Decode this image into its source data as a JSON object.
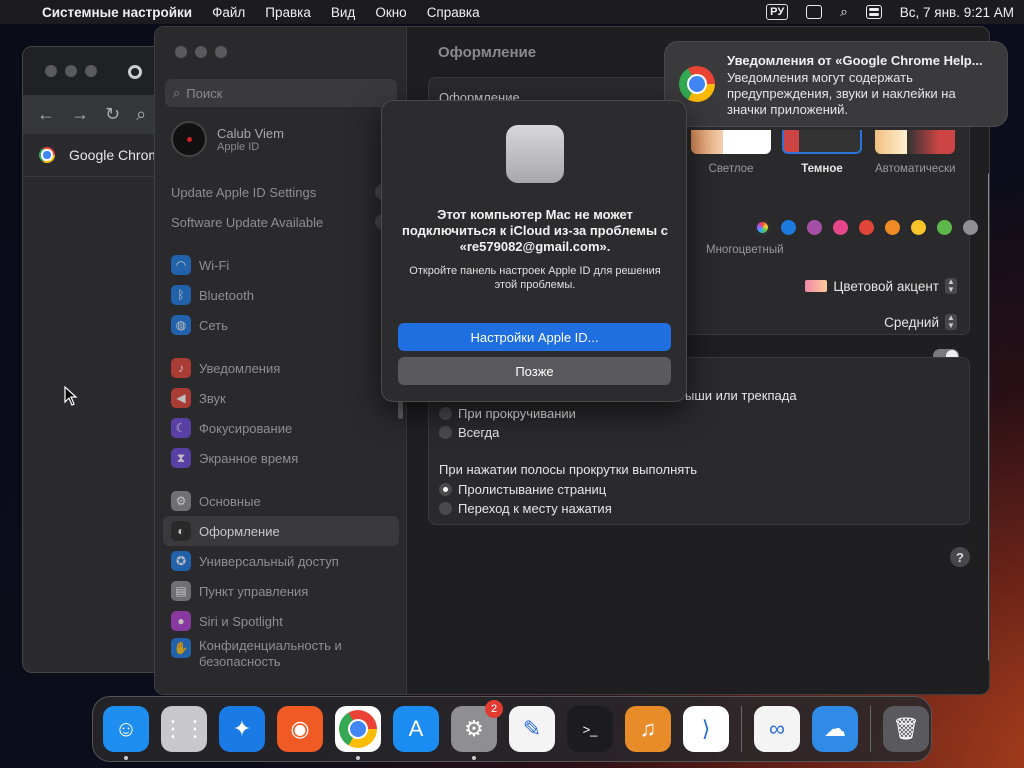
{
  "menubar": {
    "app_name": "Системные настройки",
    "items": [
      "Файл",
      "Правка",
      "Вид",
      "Окно",
      "Справка"
    ],
    "keyboard_layout": "РУ",
    "datetime": "Вс, 7 янв.  9:21 AM"
  },
  "chrome_window": {
    "bookmark_label": "Google Chrom"
  },
  "settings": {
    "search_placeholder": "Поиск",
    "profile": {
      "name": "Calub Viem",
      "sub": "Apple ID"
    },
    "alerts": [
      {
        "label": "Update Apple ID Settings",
        "badge": "1"
      },
      {
        "label": "Software Update Available",
        "badge": "1"
      }
    ],
    "group1": [
      {
        "label": "Wi-Fi",
        "icon": "wifi-icon",
        "color": "#1f7ae0"
      },
      {
        "label": "Bluetooth",
        "icon": "bluetooth-icon",
        "color": "#1f7ae0"
      },
      {
        "label": "Сеть",
        "icon": "globe-icon",
        "color": "#1f7ae0"
      }
    ],
    "group2": [
      {
        "label": "Уведомления",
        "icon": "bell-icon",
        "color": "#e0453a"
      },
      {
        "label": "Звук",
        "icon": "speaker-icon",
        "color": "#e0453a"
      },
      {
        "label": "Фокусирование",
        "icon": "moon-icon",
        "color": "#6c4ad8"
      },
      {
        "label": "Экранное время",
        "icon": "hourglass-icon",
        "color": "#6c4ad8"
      }
    ],
    "group3": [
      {
        "label": "Основные",
        "icon": "gear-icon",
        "color": "#8e8e93"
      },
      {
        "label": "Оформление",
        "icon": "appearance-icon",
        "color": "#222222",
        "selected": true
      },
      {
        "label": "Универсальный доступ",
        "icon": "accessibility-icon",
        "color": "#1f7ae0"
      },
      {
        "label": "Пункт управления",
        "icon": "control-center-icon",
        "color": "#8e8e93"
      },
      {
        "label": "Siri и Spotlight",
        "icon": "siri-icon",
        "color": "#b040d0"
      },
      {
        "label": "Конфиденциальность и безопасность",
        "icon": "hand-icon",
        "color": "#1f7ae0"
      }
    ],
    "content_title": "Оформление",
    "appearance_label": "Оформление",
    "themes": [
      {
        "label": "Светлое"
      },
      {
        "label": "Темное",
        "selected": true
      },
      {
        "label": "Автоматически"
      }
    ],
    "accent_colors": [
      "#ffffff",
      "#1f7ae0",
      "#a550a7",
      "#e6468c",
      "#e0453a",
      "#f08a24",
      "#f7c42a",
      "#5db84a",
      "#8e8e93"
    ],
    "multicolor_label": "Многоцветный",
    "accent_label": "Цветовой акцент",
    "size_label": "Средний",
    "scroll_header_partial": "ыши или трекпада",
    "scroll_options": [
      {
        "label": "При прокручивании",
        "checked": false
      },
      {
        "label": "Всегда",
        "checked": false
      }
    ],
    "click_header": "При нажатии полосы прокрутки выполнять",
    "click_options": [
      {
        "label": "Пролистывание страниц",
        "checked": true
      },
      {
        "label": "Переход к месту нажатия",
        "checked": false
      }
    ],
    "help": "?"
  },
  "notification": {
    "title": "Уведомления от «Google Chrome Help...",
    "body": "Уведомления могут содержать предупреждения, звуки и наклейки на значки приложений."
  },
  "dialog": {
    "title": "Этот компьютер Mac не может подключиться к iCloud из-за проблемы с «re579082@gmail.com».",
    "message": "Откройте панель настроек Apple ID для решения этой проблемы.",
    "primary_button": "Настройки Apple ID...",
    "secondary_button": "Позже"
  },
  "dock": {
    "items": [
      {
        "name": "finder-icon",
        "bg": "#1e8ef0",
        "running": true
      },
      {
        "name": "launchpad-icon",
        "bg": "#c8c8cc"
      },
      {
        "name": "safari-icon",
        "bg": "#1a7ae6"
      },
      {
        "name": "firefox-icon",
        "bg": "#f05a24"
      },
      {
        "name": "chrome-icon",
        "bg": "#ffffff",
        "running": true
      },
      {
        "name": "app-store-icon",
        "bg": "#1a8cf2"
      },
      {
        "name": "system-settings-icon",
        "bg": "#8e8e93",
        "running": true,
        "badge": "2"
      },
      {
        "name": "textedit-icon",
        "bg": "#f4f4f4"
      },
      {
        "name": "terminal-icon",
        "bg": "#1c1c1e"
      },
      {
        "name": "garageband-icon",
        "bg": "#e88c2a"
      },
      {
        "name": "vscode-icon",
        "bg": "#ffffff"
      },
      {
        "name": "visual-studio-icon",
        "bg": "#f4f4f4"
      },
      {
        "name": "weather-icon",
        "bg": "#2f8be6"
      },
      {
        "name": "trash-icon",
        "bg": "#5a5a5e"
      }
    ]
  }
}
